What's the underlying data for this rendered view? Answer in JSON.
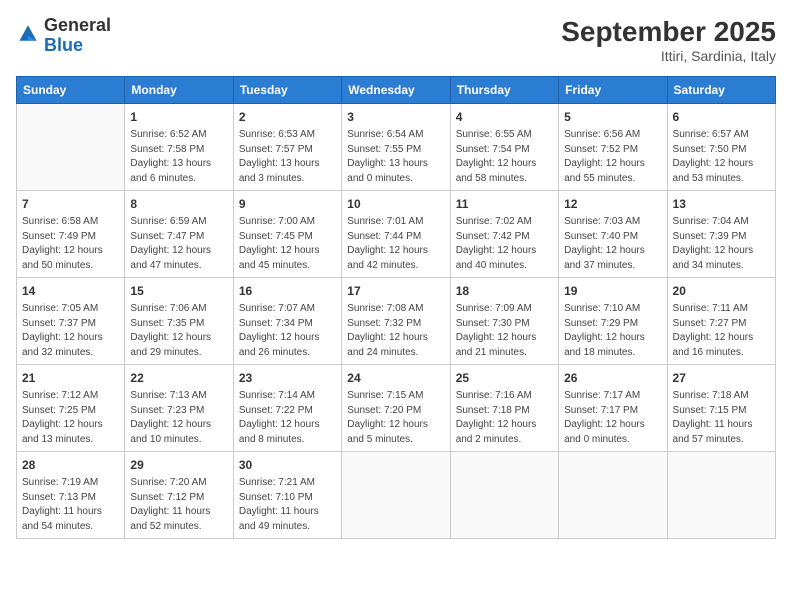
{
  "logo": {
    "general": "General",
    "blue": "Blue"
  },
  "header": {
    "month_year": "September 2025",
    "location": "Ittiri, Sardinia, Italy"
  },
  "days_of_week": [
    "Sunday",
    "Monday",
    "Tuesday",
    "Wednesday",
    "Thursday",
    "Friday",
    "Saturday"
  ],
  "weeks": [
    [
      {
        "day": "",
        "info": ""
      },
      {
        "day": "1",
        "info": "Sunrise: 6:52 AM\nSunset: 7:58 PM\nDaylight: 13 hours\nand 6 minutes."
      },
      {
        "day": "2",
        "info": "Sunrise: 6:53 AM\nSunset: 7:57 PM\nDaylight: 13 hours\nand 3 minutes."
      },
      {
        "day": "3",
        "info": "Sunrise: 6:54 AM\nSunset: 7:55 PM\nDaylight: 13 hours\nand 0 minutes."
      },
      {
        "day": "4",
        "info": "Sunrise: 6:55 AM\nSunset: 7:54 PM\nDaylight: 12 hours\nand 58 minutes."
      },
      {
        "day": "5",
        "info": "Sunrise: 6:56 AM\nSunset: 7:52 PM\nDaylight: 12 hours\nand 55 minutes."
      },
      {
        "day": "6",
        "info": "Sunrise: 6:57 AM\nSunset: 7:50 PM\nDaylight: 12 hours\nand 53 minutes."
      }
    ],
    [
      {
        "day": "7",
        "info": "Sunrise: 6:58 AM\nSunset: 7:49 PM\nDaylight: 12 hours\nand 50 minutes."
      },
      {
        "day": "8",
        "info": "Sunrise: 6:59 AM\nSunset: 7:47 PM\nDaylight: 12 hours\nand 47 minutes."
      },
      {
        "day": "9",
        "info": "Sunrise: 7:00 AM\nSunset: 7:45 PM\nDaylight: 12 hours\nand 45 minutes."
      },
      {
        "day": "10",
        "info": "Sunrise: 7:01 AM\nSunset: 7:44 PM\nDaylight: 12 hours\nand 42 minutes."
      },
      {
        "day": "11",
        "info": "Sunrise: 7:02 AM\nSunset: 7:42 PM\nDaylight: 12 hours\nand 40 minutes."
      },
      {
        "day": "12",
        "info": "Sunrise: 7:03 AM\nSunset: 7:40 PM\nDaylight: 12 hours\nand 37 minutes."
      },
      {
        "day": "13",
        "info": "Sunrise: 7:04 AM\nSunset: 7:39 PM\nDaylight: 12 hours\nand 34 minutes."
      }
    ],
    [
      {
        "day": "14",
        "info": "Sunrise: 7:05 AM\nSunset: 7:37 PM\nDaylight: 12 hours\nand 32 minutes."
      },
      {
        "day": "15",
        "info": "Sunrise: 7:06 AM\nSunset: 7:35 PM\nDaylight: 12 hours\nand 29 minutes."
      },
      {
        "day": "16",
        "info": "Sunrise: 7:07 AM\nSunset: 7:34 PM\nDaylight: 12 hours\nand 26 minutes."
      },
      {
        "day": "17",
        "info": "Sunrise: 7:08 AM\nSunset: 7:32 PM\nDaylight: 12 hours\nand 24 minutes."
      },
      {
        "day": "18",
        "info": "Sunrise: 7:09 AM\nSunset: 7:30 PM\nDaylight: 12 hours\nand 21 minutes."
      },
      {
        "day": "19",
        "info": "Sunrise: 7:10 AM\nSunset: 7:29 PM\nDaylight: 12 hours\nand 18 minutes."
      },
      {
        "day": "20",
        "info": "Sunrise: 7:11 AM\nSunset: 7:27 PM\nDaylight: 12 hours\nand 16 minutes."
      }
    ],
    [
      {
        "day": "21",
        "info": "Sunrise: 7:12 AM\nSunset: 7:25 PM\nDaylight: 12 hours\nand 13 minutes."
      },
      {
        "day": "22",
        "info": "Sunrise: 7:13 AM\nSunset: 7:23 PM\nDaylight: 12 hours\nand 10 minutes."
      },
      {
        "day": "23",
        "info": "Sunrise: 7:14 AM\nSunset: 7:22 PM\nDaylight: 12 hours\nand 8 minutes."
      },
      {
        "day": "24",
        "info": "Sunrise: 7:15 AM\nSunset: 7:20 PM\nDaylight: 12 hours\nand 5 minutes."
      },
      {
        "day": "25",
        "info": "Sunrise: 7:16 AM\nSunset: 7:18 PM\nDaylight: 12 hours\nand 2 minutes."
      },
      {
        "day": "26",
        "info": "Sunrise: 7:17 AM\nSunset: 7:17 PM\nDaylight: 12 hours\nand 0 minutes."
      },
      {
        "day": "27",
        "info": "Sunrise: 7:18 AM\nSunset: 7:15 PM\nDaylight: 11 hours\nand 57 minutes."
      }
    ],
    [
      {
        "day": "28",
        "info": "Sunrise: 7:19 AM\nSunset: 7:13 PM\nDaylight: 11 hours\nand 54 minutes."
      },
      {
        "day": "29",
        "info": "Sunrise: 7:20 AM\nSunset: 7:12 PM\nDaylight: 11 hours\nand 52 minutes."
      },
      {
        "day": "30",
        "info": "Sunrise: 7:21 AM\nSunset: 7:10 PM\nDaylight: 11 hours\nand 49 minutes."
      },
      {
        "day": "",
        "info": ""
      },
      {
        "day": "",
        "info": ""
      },
      {
        "day": "",
        "info": ""
      },
      {
        "day": "",
        "info": ""
      }
    ]
  ]
}
